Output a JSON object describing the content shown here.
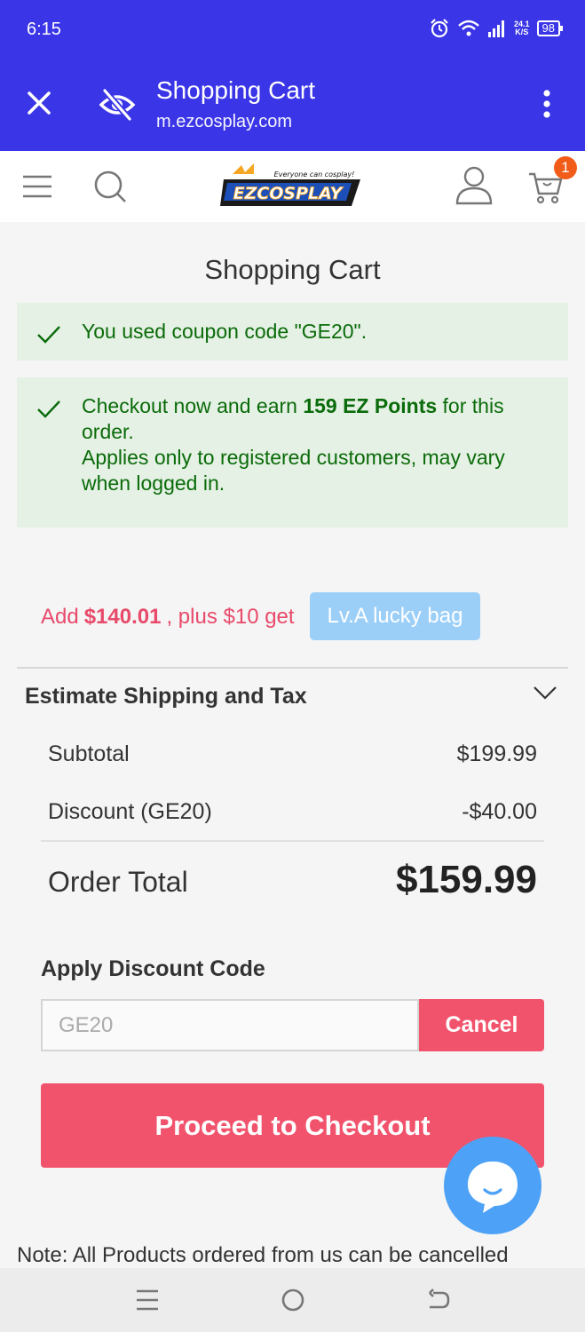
{
  "status_bar": {
    "time": "6:15",
    "net_speed_value": "24.1",
    "net_speed_unit": "K/S",
    "battery": "98",
    "icons": [
      "alarm-icon",
      "wifi-icon",
      "signal-icon"
    ]
  },
  "browser": {
    "title": "Shopping Cart",
    "url": "m.ezcosplay.com",
    "icons": [
      "close-icon",
      "eye-off-icon",
      "more-vert-icon"
    ]
  },
  "site_nav": {
    "logo_tagline": "Everyone can cosplay!",
    "logo_text": "EZCOSPLAY",
    "cart_count": "1",
    "icons": [
      "menu-icon",
      "search-icon",
      "account-icon",
      "cart-icon"
    ]
  },
  "page_title": "Shopping Cart",
  "messages": {
    "coupon": "You used coupon code \"GE20\".",
    "points_prefix": "Checkout now and earn ",
    "points_bold": "159 EZ Points",
    "points_suffix": " for this order.",
    "points_note": "Applies only to registered customers, may vary when logged in."
  },
  "upsell": {
    "prefix": "Add",
    "amount": "$140.01",
    "suffix": ", plus $10 get",
    "button": "Lv.A lucky bag"
  },
  "summary": {
    "shipping_label": "Estimate Shipping and Tax",
    "subtotal_label": "Subtotal",
    "subtotal_value": "$199.99",
    "discount_label": "Discount (GE20)",
    "discount_value": "-$40.00",
    "total_label": "Order Total",
    "total_value": "$159.99"
  },
  "discount": {
    "title": "Apply Discount Code",
    "code_value": "GE20",
    "cancel_label": "Cancel"
  },
  "checkout_label": "Proceed to Checkout",
  "note": "Note: All Products ordered from us can be cancelled",
  "colors": {
    "brand_bar": "#3a35e6",
    "accent": "#f1536c",
    "success_bg": "#e5f1e4",
    "success_text": "#0a6b0a",
    "info_button": "#9ccff8",
    "chat": "#4da2f7"
  }
}
